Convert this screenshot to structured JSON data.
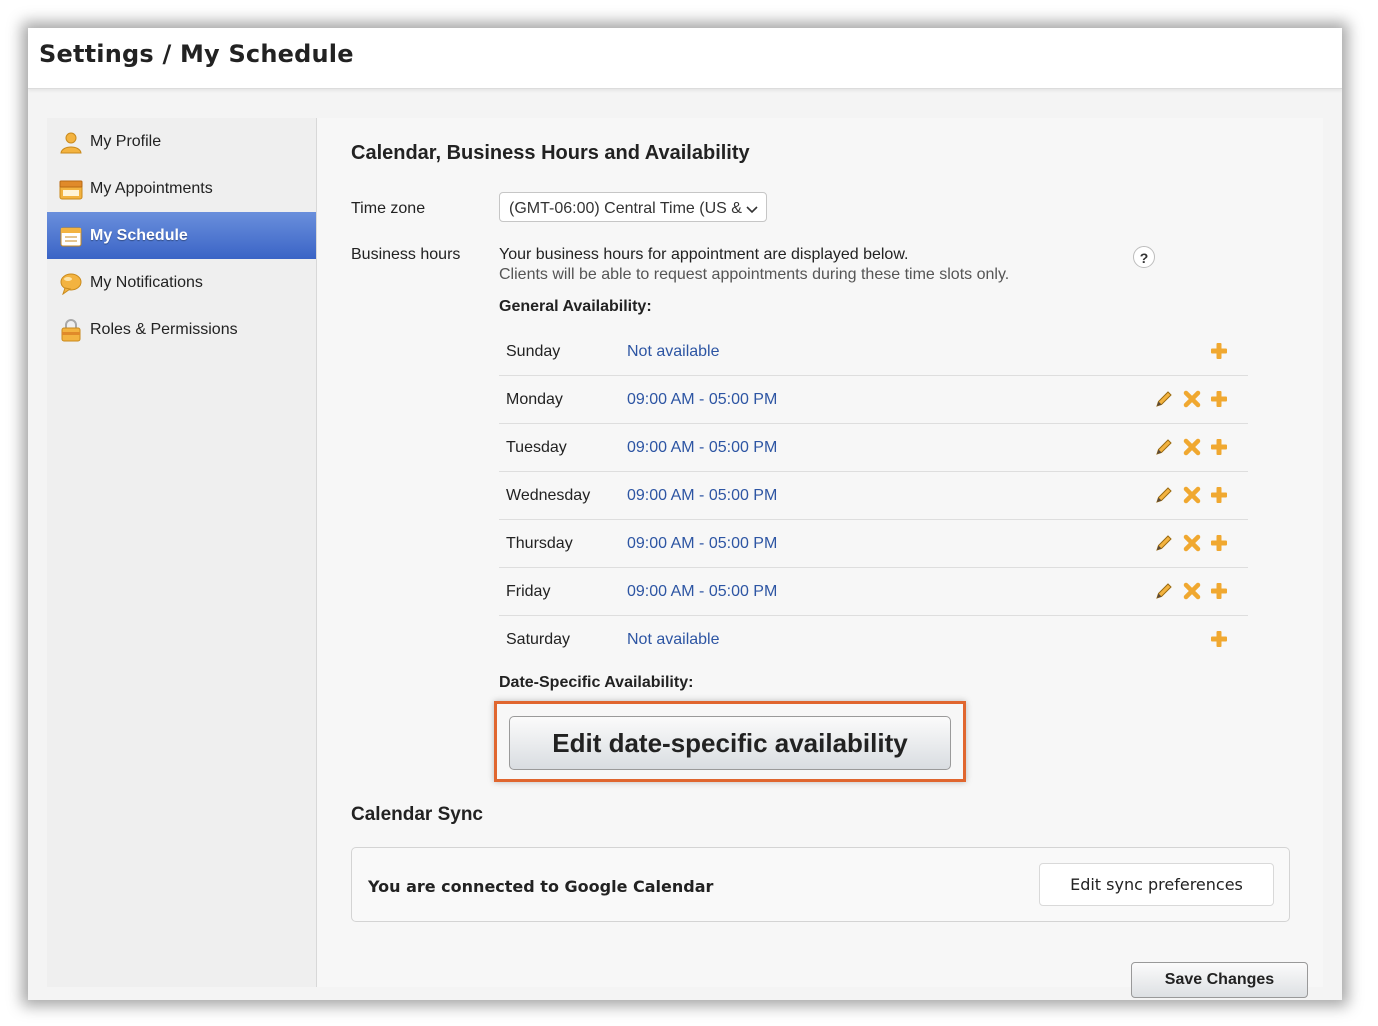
{
  "header": {
    "title": "Settings / My Schedule"
  },
  "sidebar": {
    "items": [
      {
        "label": "My Profile",
        "icon": "profile-icon",
        "active": false
      },
      {
        "label": "My Appointments",
        "icon": "appointments-icon",
        "active": false
      },
      {
        "label": "My Schedule",
        "icon": "calendar-icon",
        "active": true
      },
      {
        "label": "My Notifications",
        "icon": "notifications-icon",
        "active": false
      },
      {
        "label": "Roles & Permissions",
        "icon": "lock-icon",
        "active": false
      }
    ]
  },
  "main": {
    "section_title": "Calendar, Business Hours and Availability",
    "timezone": {
      "label": "Time zone",
      "value": "(GMT-06:00) Central Time (US &"
    },
    "business_hours": {
      "label": "Business hours",
      "line1": "Your business hours for appointment are displayed below.",
      "line2": "Clients will be able to request appointments during these time slots only.",
      "help": "?"
    },
    "general_heading": "General Availability:",
    "days": [
      {
        "name": "Sunday",
        "hours": "Not available",
        "editable": false
      },
      {
        "name": "Monday",
        "hours": "09:00 AM - 05:00 PM",
        "editable": true
      },
      {
        "name": "Tuesday",
        "hours": "09:00 AM - 05:00 PM",
        "editable": true
      },
      {
        "name": "Wednesday",
        "hours": "09:00 AM - 05:00 PM",
        "editable": true
      },
      {
        "name": "Thursday",
        "hours": "09:00 AM - 05:00 PM",
        "editable": true
      },
      {
        "name": "Friday",
        "hours": "09:00 AM - 05:00 PM",
        "editable": true
      },
      {
        "name": "Saturday",
        "hours": "Not available",
        "editable": false
      }
    ],
    "date_specific_heading": "Date-Specific Availability:",
    "edit_date_button": "Edit date-specific availability",
    "calendar_sync": {
      "title": "Calendar Sync",
      "status": "You are connected to Google Calendar",
      "button": "Edit sync preferences"
    },
    "save_button": "Save Changes"
  },
  "colors": {
    "accent": "#3a64c6",
    "link": "#2d55a3",
    "highlight": "#e0662f",
    "icon_orange": "#f0a830"
  }
}
